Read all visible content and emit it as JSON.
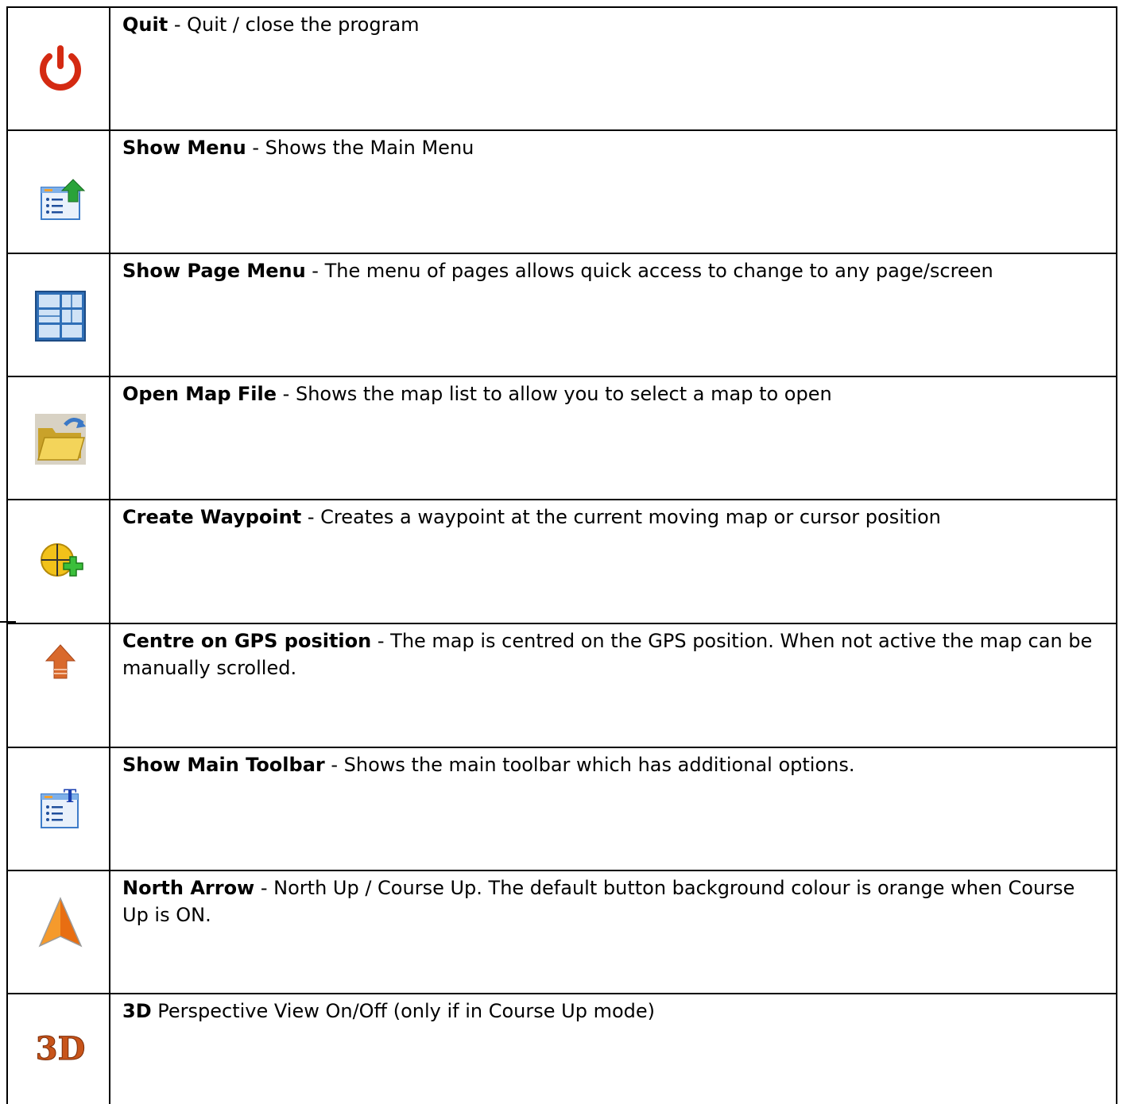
{
  "rows": [
    {
      "icon": "power-icon",
      "title": "Quit",
      "desc": " - Quit / close the program"
    },
    {
      "icon": "show-menu-icon",
      "title": "Show Menu",
      "desc": " - Shows the Main Menu"
    },
    {
      "icon": "page-menu-icon",
      "title": "Show Page Menu",
      "desc": " - The menu of pages allows quick access to change to any page/screen"
    },
    {
      "icon": "open-folder-icon",
      "title": "Open Map File",
      "desc": " - Shows the map list to allow you to select a map to open"
    },
    {
      "icon": "create-waypoint-icon",
      "title": "Create Waypoint",
      "desc": " - Creates a waypoint at the current moving map or cursor position"
    },
    {
      "icon": "centre-gps-arrow-icon",
      "title": "Centre on GPS position",
      "desc": " - The map is centred on the GPS position. When not active the map can be manually scrolled."
    },
    {
      "icon": "main-toolbar-icon",
      "title": "Show Main Toolbar",
      "desc": " - Shows the main toolbar which has additional options."
    },
    {
      "icon": "north-arrow-icon",
      "title": "North Arrow",
      "desc": " - North Up / Course Up. The default button background colour is orange when Course Up is ON."
    },
    {
      "icon": "3d-view-icon",
      "title": "3D",
      "desc": " Perspective View On/Off (only if in Course Up mode)"
    }
  ]
}
